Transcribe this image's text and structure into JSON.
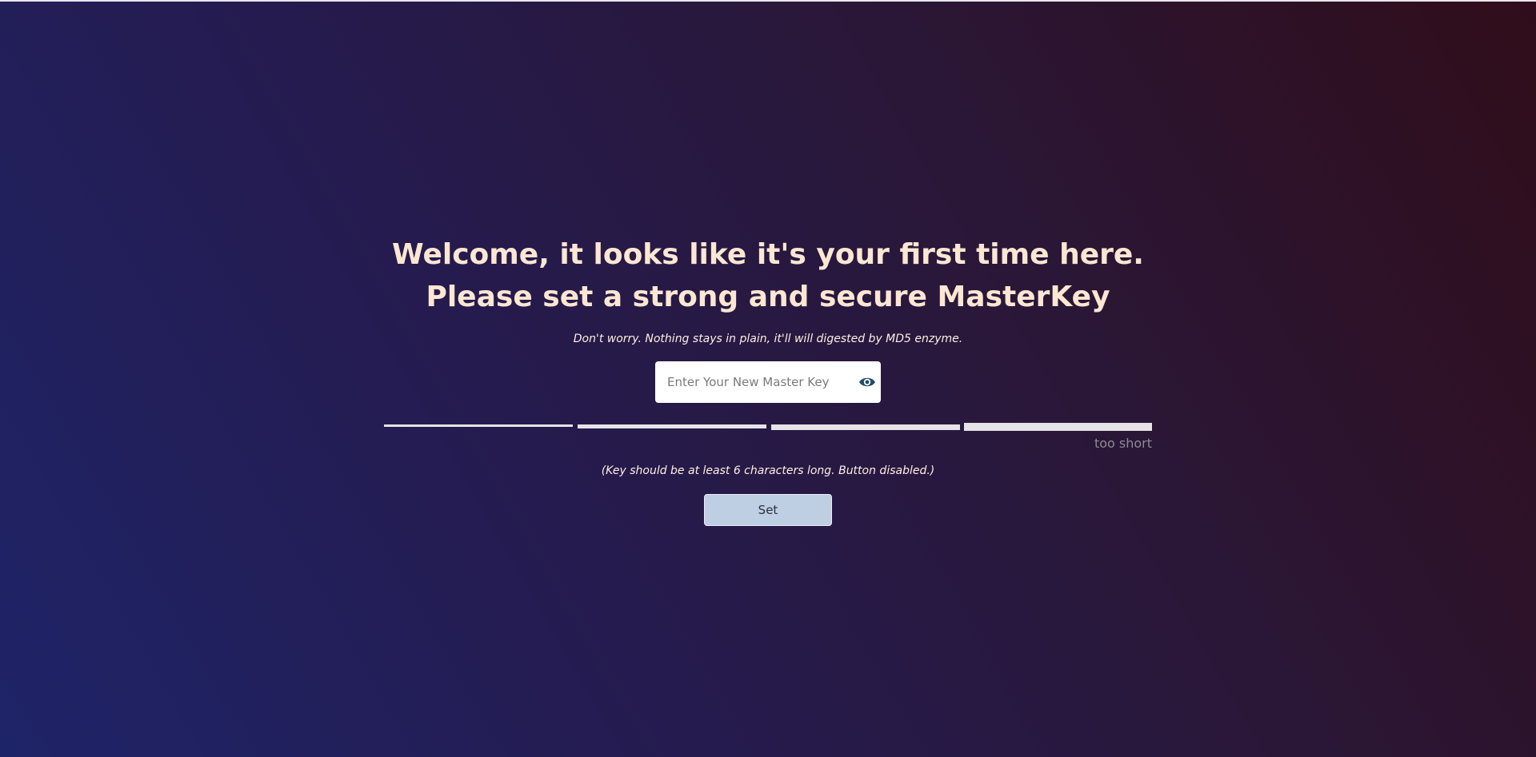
{
  "welcome": {
    "title": "Welcome, it looks like it's your first time here. Please set a strong and secure MasterKey",
    "note": "Don't worry. Nothing stays in plain, it'll will digested by MD5 enzyme."
  },
  "key_input": {
    "placeholder": "Enter Your New Master Key",
    "value": "",
    "toggle_icon": "eye-icon"
  },
  "strength_meter": {
    "segments": 4,
    "label": "too short"
  },
  "hint": "(Key should be at least 6 characters long. Button disabled.)",
  "set_button": {
    "label": "Set",
    "disabled": true
  },
  "colors": {
    "heading": "#fde6d2",
    "button_bg": "#bfcfe3",
    "eye_icon": "#1d4d6e"
  }
}
